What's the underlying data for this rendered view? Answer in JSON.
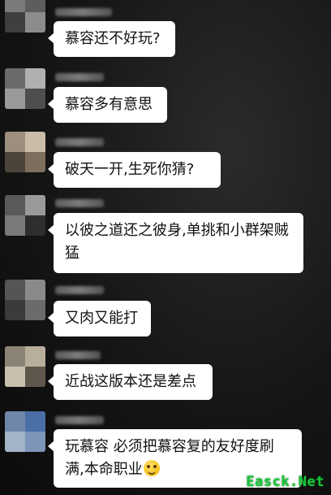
{
  "messages": [
    {
      "text": "慕容还不好玩?"
    },
    {
      "text": "慕容多有意思"
    },
    {
      "text": "破天一开,生死你猜?"
    },
    {
      "text": "以彼之道还之彼身,单挑和小群架贼猛"
    },
    {
      "text": "又肉又能打"
    },
    {
      "text": "近战这版本还是差点"
    },
    {
      "text": "玩慕容 必须把慕容复的友好度刷满,本命职业"
    }
  ],
  "watermark": "Easck.Net",
  "icons": {
    "emoji": "smiling-blush-emoji-icon"
  },
  "colors": {
    "bubble": "#ffffff",
    "watermark": "#18c83a"
  }
}
